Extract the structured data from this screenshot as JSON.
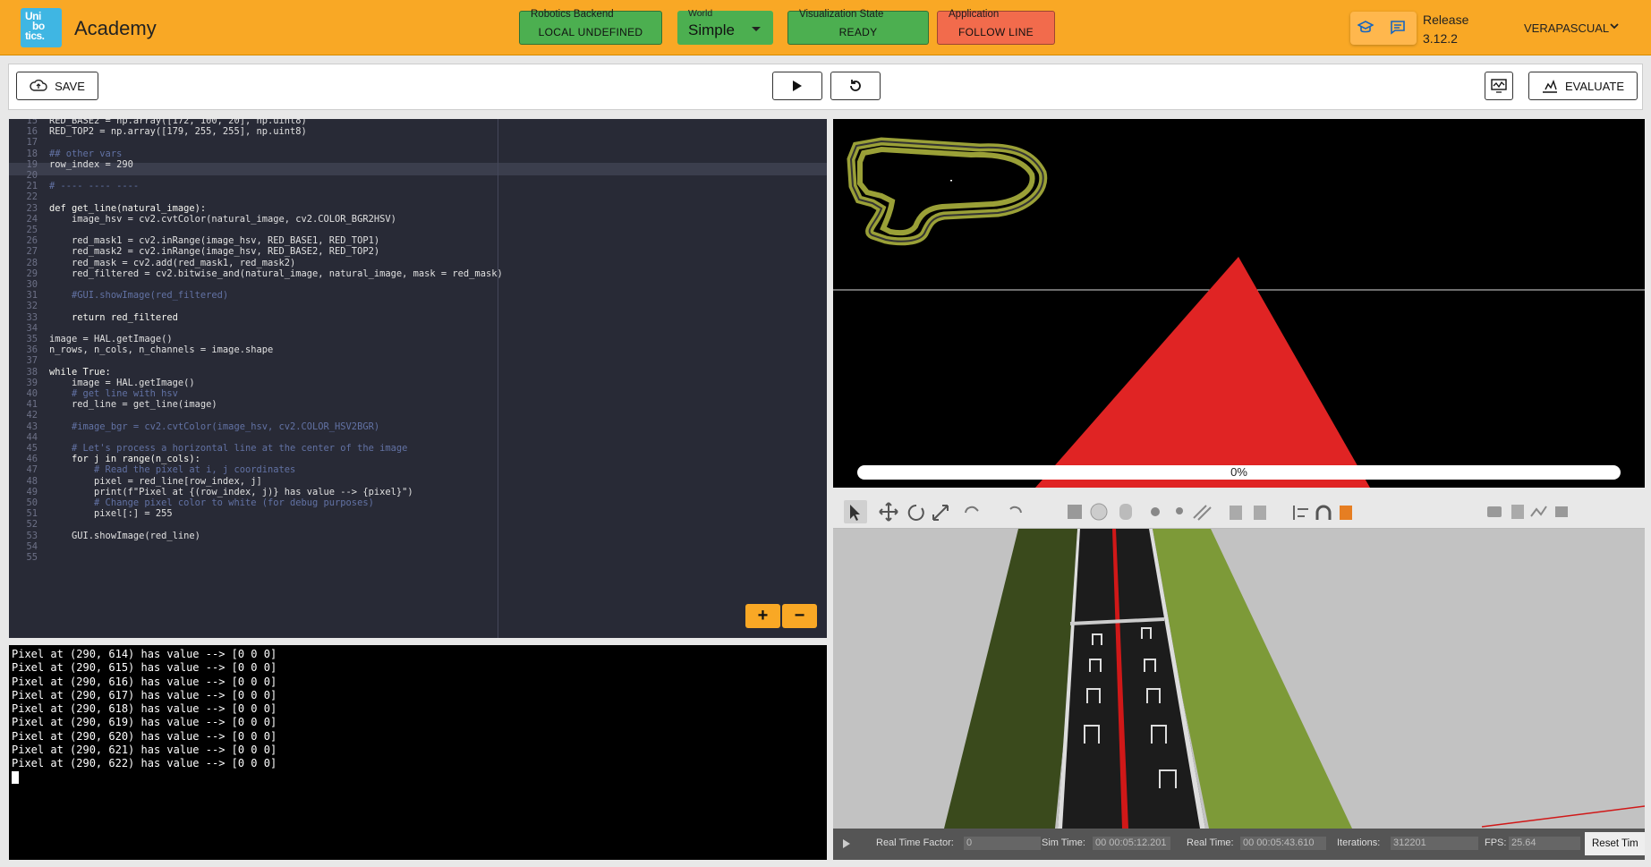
{
  "header": {
    "logo": [
      "Uni",
      "bo",
      "tics."
    ],
    "app_name": "Academy",
    "backend": {
      "caption": "Robotics Backend",
      "value": "LOCAL UNDEFINED"
    },
    "world": {
      "caption": "World",
      "value": "Simple"
    },
    "viz_state": {
      "caption": "Visualization State",
      "value": "READY"
    },
    "application": {
      "caption": "Application",
      "value": "FOLLOW LINE"
    },
    "release_label": "Release",
    "release_version": "3.12.2",
    "user": "VERAPASCUAL"
  },
  "toolbar": {
    "save": "SAVE",
    "evaluate": "EVALUATE"
  },
  "editor": {
    "lines": [
      {
        "n": "15",
        "t": "RED_BASE2 = np.array([172, 100, 20], np.uint8)"
      },
      {
        "n": "16",
        "t": "RED_TOP2 = np.array([179, 255, 255], np.uint8)"
      },
      {
        "n": "17",
        "t": ""
      },
      {
        "n": "18",
        "t": "## other vars"
      },
      {
        "n": "19",
        "t": "row_index = 290"
      },
      {
        "n": "20",
        "t": ""
      },
      {
        "n": "21",
        "t": "# ---- ---- ----"
      },
      {
        "n": "22",
        "t": ""
      },
      {
        "n": "23",
        "t": "def get_line(natural_image):"
      },
      {
        "n": "24",
        "t": "    image_hsv = cv2.cvtColor(natural_image, cv2.COLOR_BGR2HSV)"
      },
      {
        "n": "25",
        "t": ""
      },
      {
        "n": "26",
        "t": "    red_mask1 = cv2.inRange(image_hsv, RED_BASE1, RED_TOP1)"
      },
      {
        "n": "27",
        "t": "    red_mask2 = cv2.inRange(image_hsv, RED_BASE2, RED_TOP2)"
      },
      {
        "n": "28",
        "t": "    red_mask = cv2.add(red_mask1, red_mask2)"
      },
      {
        "n": "29",
        "t": "    red_filtered = cv2.bitwise_and(natural_image, natural_image, mask = red_mask)"
      },
      {
        "n": "30",
        "t": ""
      },
      {
        "n": "31",
        "t": "    #GUI.showImage(red_filtered)"
      },
      {
        "n": "32",
        "t": ""
      },
      {
        "n": "33",
        "t": "    return red_filtered"
      },
      {
        "n": "34",
        "t": ""
      },
      {
        "n": "35",
        "t": "image = HAL.getImage()"
      },
      {
        "n": "36",
        "t": "n_rows, n_cols, n_channels = image.shape"
      },
      {
        "n": "37",
        "t": ""
      },
      {
        "n": "38",
        "t": "while True:"
      },
      {
        "n": "39",
        "t": "    image = HAL.getImage()"
      },
      {
        "n": "40",
        "t": "    # get line with hsv"
      },
      {
        "n": "41",
        "t": "    red_line = get_line(image)"
      },
      {
        "n": "42",
        "t": ""
      },
      {
        "n": "43",
        "t": "    #image_bgr = cv2.cvtColor(image_hsv, cv2.COLOR_HSV2BGR)"
      },
      {
        "n": "44",
        "t": ""
      },
      {
        "n": "45",
        "t": "    # Let's process a horizontal line at the center of the image"
      },
      {
        "n": "46",
        "t": "    for j in range(n_cols):"
      },
      {
        "n": "47",
        "t": "        # Read the pixel at i, j coordinates"
      },
      {
        "n": "48",
        "t": "        pixel = red_line[row_index, j]"
      },
      {
        "n": "49",
        "t": "        print(f\"Pixel at {(row_index, j)} has value --> {pixel}\")"
      },
      {
        "n": "50",
        "t": "        # Change pixel color to white (for debug purposes)"
      },
      {
        "n": "51",
        "t": "        pixel[:] = 255"
      },
      {
        "n": "52",
        "t": ""
      },
      {
        "n": "53",
        "t": "    GUI.showImage(red_line)"
      },
      {
        "n": "54",
        "t": ""
      },
      {
        "n": "55",
        "t": ""
      }
    ]
  },
  "terminal": {
    "lines": [
      "Pixel at (290, 614) has value --> [0 0 0]",
      "Pixel at (290, 615) has value --> [0 0 0]",
      "Pixel at (290, 616) has value --> [0 0 0]",
      "Pixel at (290, 617) has value --> [0 0 0]",
      "Pixel at (290, 618) has value --> [0 0 0]",
      "Pixel at (290, 619) has value --> [0 0 0]",
      "Pixel at (290, 620) has value --> [0 0 0]",
      "Pixel at (290, 621) has value --> [0 0 0]",
      "Pixel at (290, 622) has value --> [0 0 0]"
    ]
  },
  "visualization": {
    "progress_label": "0%",
    "progress": 0
  },
  "sim": {
    "rtf_label": "Real Time Factor:",
    "rtf_value": "0",
    "sim_time_label": "Sim Time:",
    "sim_time": "00 00:05:12.201",
    "real_time_label": "Real Time:",
    "real_time": "00 00:05:43.610",
    "iterations_label": "Iterations:",
    "iterations": "312201",
    "fps_label": "FPS:",
    "fps": "25.64",
    "reset_label": "Reset Tim"
  },
  "colors": {
    "header": "#f9a825",
    "green": "#4caf50",
    "red_badge": "#f26b4c",
    "editor_bg": "#282a36"
  }
}
